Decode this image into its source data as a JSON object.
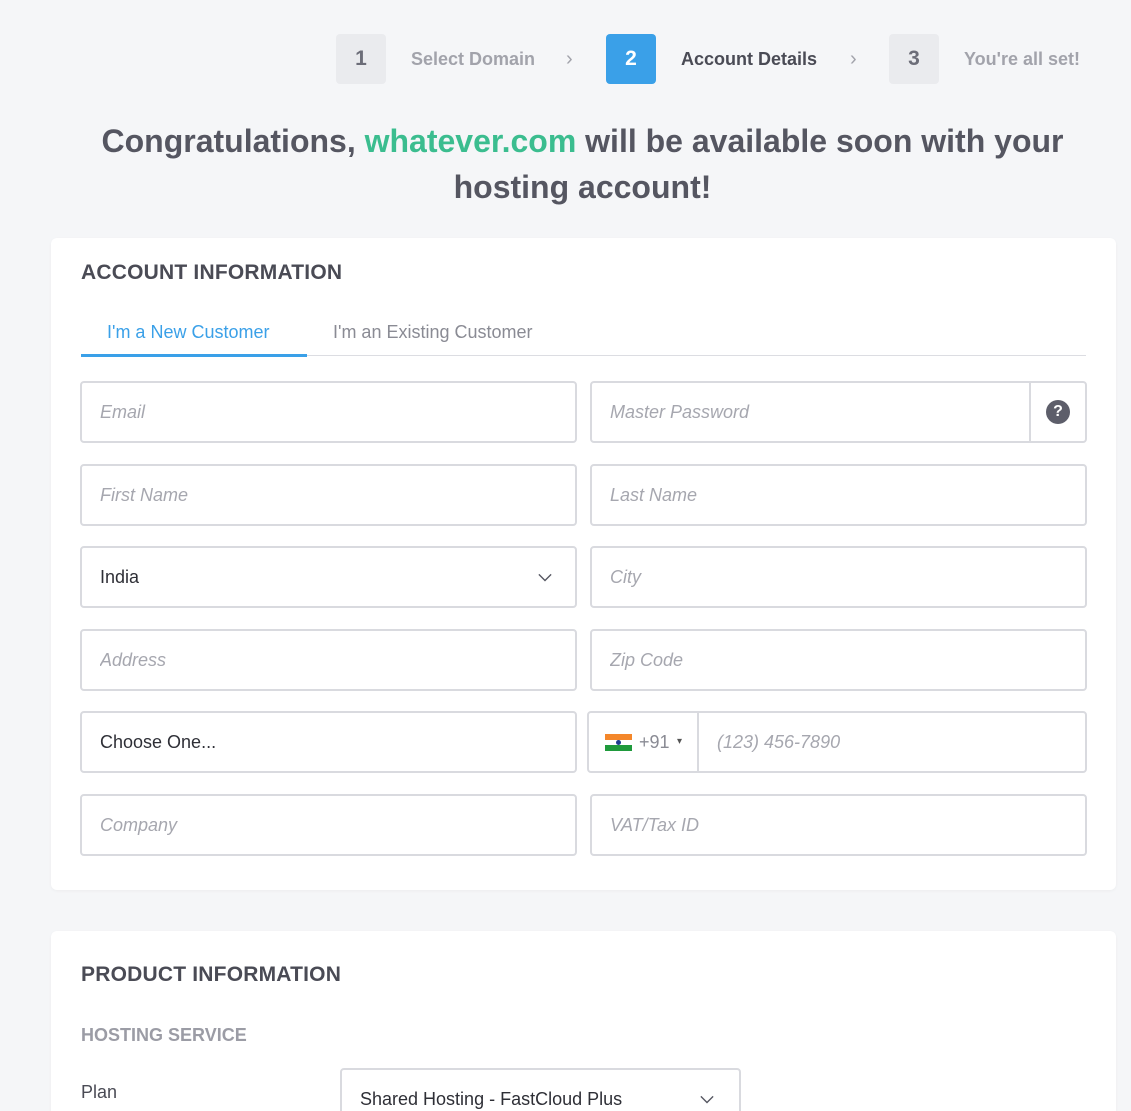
{
  "stepper": {
    "steps": [
      {
        "number": "1",
        "label": "Select Domain",
        "state": "inactive"
      },
      {
        "number": "2",
        "label": "Account Details",
        "state": "active"
      },
      {
        "number": "3",
        "label": "You're all set!",
        "state": "inactive"
      }
    ],
    "separator_icon": "chevron-right-icon"
  },
  "headline": {
    "prefix": "Congratulations,",
    "domain": "whatever.com",
    "suffix": "will be available soon with your hosting account!"
  },
  "account": {
    "title": "ACCOUNT INFORMATION",
    "tabs": [
      {
        "label": "I'm a New Customer",
        "active": true
      },
      {
        "label": "I'm an Existing Customer",
        "active": false
      }
    ],
    "fields": {
      "email": {
        "placeholder": "Email",
        "value": ""
      },
      "password": {
        "placeholder": "Master Password",
        "value": "",
        "help_icon": "question-circle-icon",
        "help_glyph": "?"
      },
      "first_name": {
        "placeholder": "First Name",
        "value": ""
      },
      "last_name": {
        "placeholder": "Last Name",
        "value": ""
      },
      "country": {
        "value": "India",
        "icon": "chevron-down-icon"
      },
      "city": {
        "placeholder": "City",
        "value": ""
      },
      "address": {
        "placeholder": "Address",
        "value": ""
      },
      "zip": {
        "placeholder": "Zip Code",
        "value": ""
      },
      "state": {
        "value": "Choose One..."
      },
      "phone": {
        "dial_code": "+91",
        "caret": "▾",
        "flag_icon": "india-flag-icon",
        "placeholder": "(123) 456-7890",
        "value": ""
      },
      "company": {
        "placeholder": "Company",
        "value": ""
      },
      "vat": {
        "placeholder": "VAT/Tax ID",
        "value": ""
      }
    }
  },
  "product": {
    "title": "PRODUCT INFORMATION",
    "subtitle": "HOSTING SERVICE",
    "plan_label": "Plan",
    "plan_value": "Shared Hosting - FastCloud Plus",
    "plan_icon": "chevron-down-icon"
  },
  "colors": {
    "accent_blue": "#3aa0e8",
    "domain_green": "#3bbd8f",
    "text_dark": "#555661",
    "border": "#d9dadf",
    "background": "#f5f6f8"
  }
}
